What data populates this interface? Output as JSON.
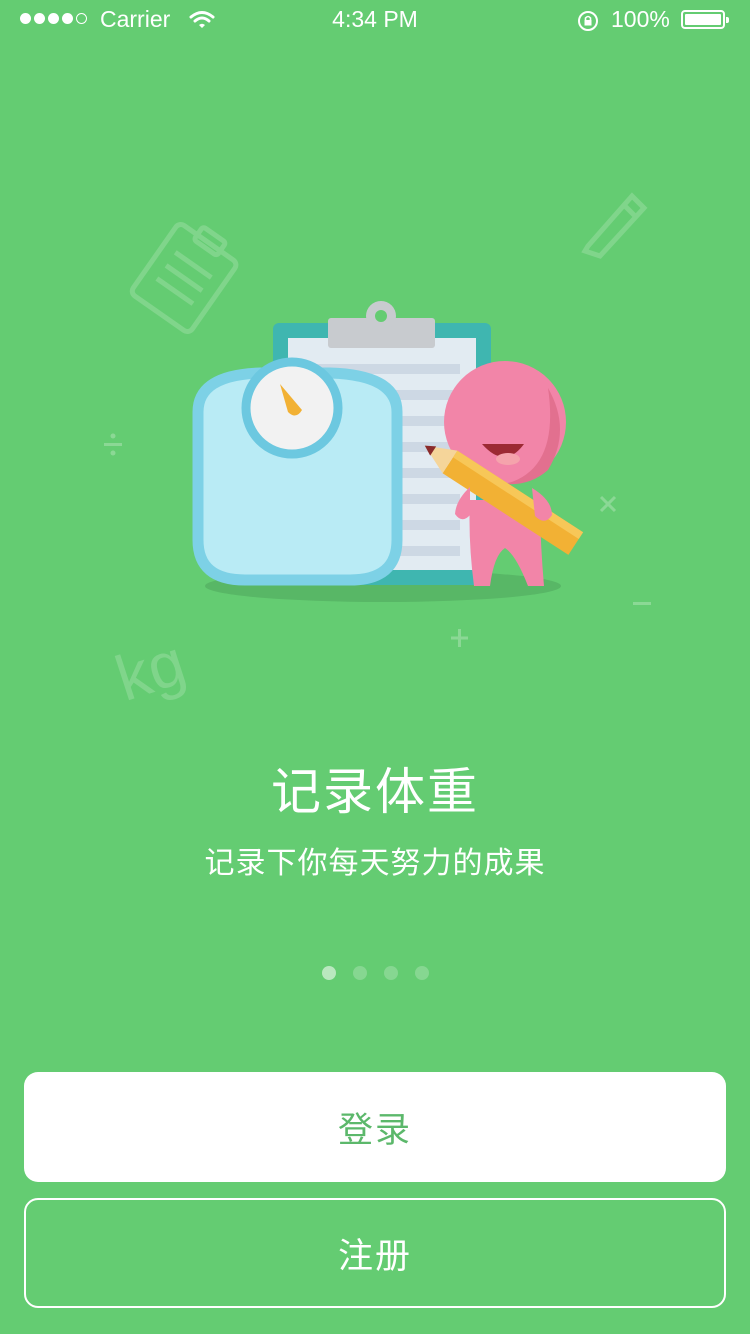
{
  "status_bar": {
    "signal_dots_filled": 4,
    "signal_dots_total": 5,
    "carrier": "Carrier",
    "time": "4:34 PM",
    "battery_percent": "100%",
    "icons": [
      "wifi-icon",
      "rotation-lock-icon",
      "battery-icon"
    ]
  },
  "onboarding": {
    "title": "记录体重",
    "subtitle": "记录下你每天努力的成果",
    "decorations": {
      "unit": "kg"
    },
    "page_indicator": {
      "total": 4,
      "current": 1
    }
  },
  "actions": {
    "login_label": "登录",
    "register_label": "注册"
  },
  "colors": {
    "background": "#64cc72",
    "login_text": "#5cb86b",
    "character": "#f285a8",
    "scale": "#b9ebf5",
    "clipboard": "#3fb6b0"
  }
}
